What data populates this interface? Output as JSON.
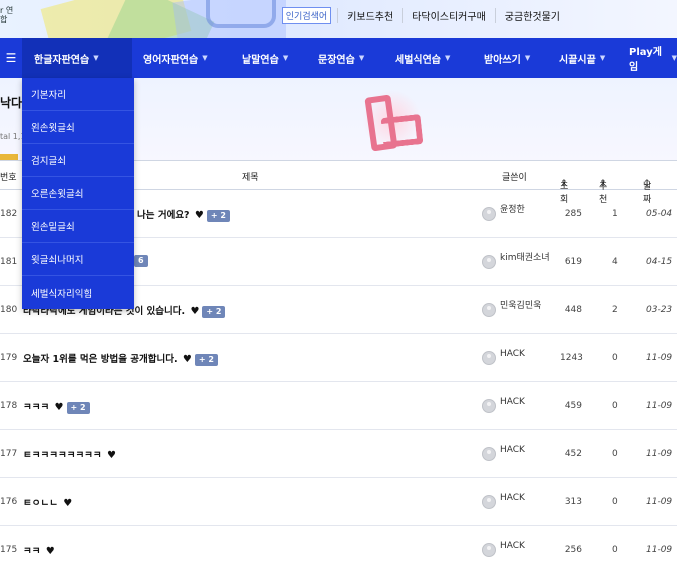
{
  "top": {
    "logo_fragment": "r 연합",
    "popular_badge": "인기검색어",
    "links": [
      "키보드추천",
      "타닥이스티커구매",
      "궁금한것물기"
    ]
  },
  "nav": {
    "menu_icon": "hamburger-icon",
    "items": [
      {
        "label": "한글자판연습"
      },
      {
        "label": "영어자판연습"
      },
      {
        "label": "낱말연습"
      },
      {
        "label": "문장연습"
      },
      {
        "label": "세벌식연습"
      },
      {
        "label": "받아쓰기"
      },
      {
        "label": "시끝시끝"
      },
      {
        "label": "Play게임"
      }
    ]
  },
  "hero": {
    "title_fragment": "낙다",
    "total_fragment": "tal 1,1"
  },
  "dropdown": {
    "items": [
      "기본자리",
      "왼손윗글쇠",
      "검지글쇠",
      "오른손윗글쇠",
      "왼손밑글쇠",
      "윗글쇠나머지",
      "세벌식자리익힘"
    ]
  },
  "table": {
    "headers": {
      "num": "번호",
      "title": "제목",
      "author": "글쓴이",
      "views": "조회",
      "recommend": "추천",
      "date": "날짜"
    },
    "rows": [
      {
        "num": "182",
        "title": "야 나는 거에요?",
        "comments": "+ 2",
        "author": "윤정한",
        "views": "285",
        "recommend": "1",
        "date": "05-04"
      },
      {
        "num": "181",
        "title": "",
        "comments": "6",
        "author": "kim태권소녀",
        "views": "619",
        "recommend": "4",
        "date": "04-15"
      },
      {
        "num": "180",
        "title": "타닥타닥에도 게임이라는 것이 있습니다.",
        "comments": "+ 2",
        "author": "민욱김민욱",
        "views": "448",
        "recommend": "2",
        "date": "03-23"
      },
      {
        "num": "179",
        "title": "오늘자 1위를 먹은 방법을 공개합니다.",
        "comments": "+ 2",
        "author": "HACK",
        "views": "1243",
        "recommend": "0",
        "date": "11-09"
      },
      {
        "num": "178",
        "title": "ㅋㅋㅋ",
        "comments": "+ 2",
        "author": "HACK",
        "views": "459",
        "recommend": "0",
        "date": "11-09"
      },
      {
        "num": "177",
        "title": "ㅌㅋㅋㅋㅋㅋㅋㅋㅋ",
        "comments": "",
        "author": "HACK",
        "views": "452",
        "recommend": "0",
        "date": "11-09"
      },
      {
        "num": "176",
        "title": "ㅌㅇㄴㄴ",
        "comments": "",
        "author": "HACK",
        "views": "313",
        "recommend": "0",
        "date": "11-09"
      },
      {
        "num": "175",
        "title": "ㅋㅋ",
        "comments": "",
        "author": "HACK",
        "views": "256",
        "recommend": "0",
        "date": "11-09"
      }
    ]
  }
}
